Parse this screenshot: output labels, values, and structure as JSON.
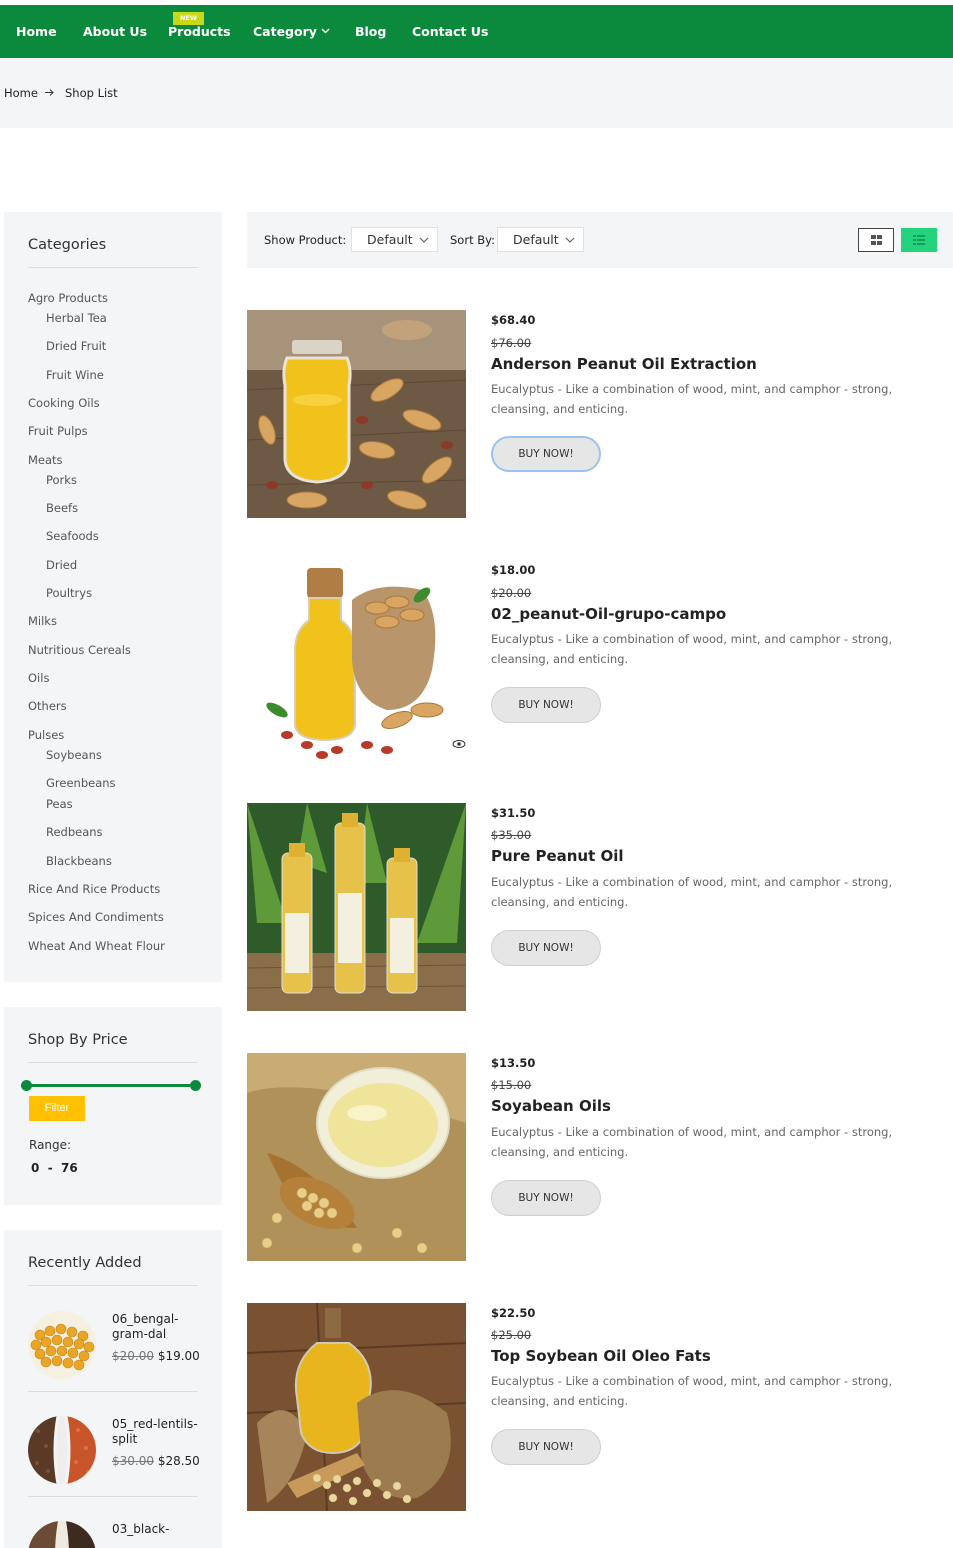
{
  "nav": {
    "items": [
      "Home",
      "About Us",
      "Products",
      "Category",
      "Blog",
      "Contact Us"
    ],
    "new_badge": "NEW"
  },
  "breadcrumb": {
    "home": "Home",
    "current": "Shop List"
  },
  "sidebar": {
    "categories_title": "Categories",
    "categories": [
      "Agro Products",
      "Herbal Tea",
      "Dried Fruit",
      "Fruit Wine",
      "Cooking Oils",
      "Fruit Pulps",
      "Meats",
      "Porks",
      "Beefs",
      "Seafoods",
      "Dried",
      "Poultrys",
      "Milks",
      "Nutritious Cereals",
      "Oils",
      "Others",
      "Pulses",
      "Soybeans",
      "Greenbeans",
      "Peas",
      "Redbeans",
      "Blackbeans",
      "Rice And Rice Products",
      "Spices And Condiments",
      "Wheat And Wheat Flour"
    ],
    "price_title": "Shop By Price",
    "filter_label": "Filter",
    "range_label": "Range:",
    "range_value": "0  -  76",
    "price_range": {
      "min": 0,
      "max": 76
    },
    "recent_title": "Recently Added",
    "recent": [
      {
        "name": "06_bengal-gram-dal",
        "old_price": "$20.00",
        "price": "$19.00"
      },
      {
        "name": "05_red-lentils-split",
        "old_price": "$30.00",
        "price": "$28.50"
      },
      {
        "name": "03_black-",
        "old_price": "",
        "price": ""
      }
    ]
  },
  "toolbar": {
    "show_label": "Show Product:",
    "show_value": "Default",
    "sort_label": "Sort By:",
    "sort_value": "Default"
  },
  "products": [
    {
      "price": "$68.40",
      "old_price": "$76.00",
      "name": "Anderson Peanut Oil Extraction",
      "desc": "Eucalyptus - Like a combination of wood, mint, and camphor - strong, cleansing, and enticing.",
      "button": "BUY NOW!"
    },
    {
      "price": "$18.00",
      "old_price": "$20.00",
      "name": "02_peanut-Oil-grupo-campo",
      "desc": "Eucalyptus - Like a combination of wood, mint, and camphor - strong, cleansing, and enticing.",
      "button": "BUY NOW!"
    },
    {
      "price": "$31.50",
      "old_price": "$35.00",
      "name": "Pure Peanut Oil",
      "desc": "Eucalyptus - Like a combination of wood, mint, and camphor - strong, cleansing, and enticing.",
      "button": "BUY NOW!"
    },
    {
      "price": "$13.50",
      "old_price": "$15.00",
      "name": "Soyabean Oils",
      "desc": "Eucalyptus - Like a combination of wood, mint, and camphor - strong, cleansing, and enticing.",
      "button": "BUY NOW!"
    },
    {
      "price": "$22.50",
      "old_price": "$25.00",
      "name": "Top Soybean Oil Oleo Fats",
      "desc": "Eucalyptus - Like a combination of wood, mint, and camphor - strong, cleansing, and enticing.",
      "button": "BUY NOW!"
    }
  ],
  "colors": {
    "brand_green": "#0b8a3e",
    "filter_yellow": "#ffc000",
    "list_view_active": "#23d47c",
    "badge": "#c8d81a"
  }
}
